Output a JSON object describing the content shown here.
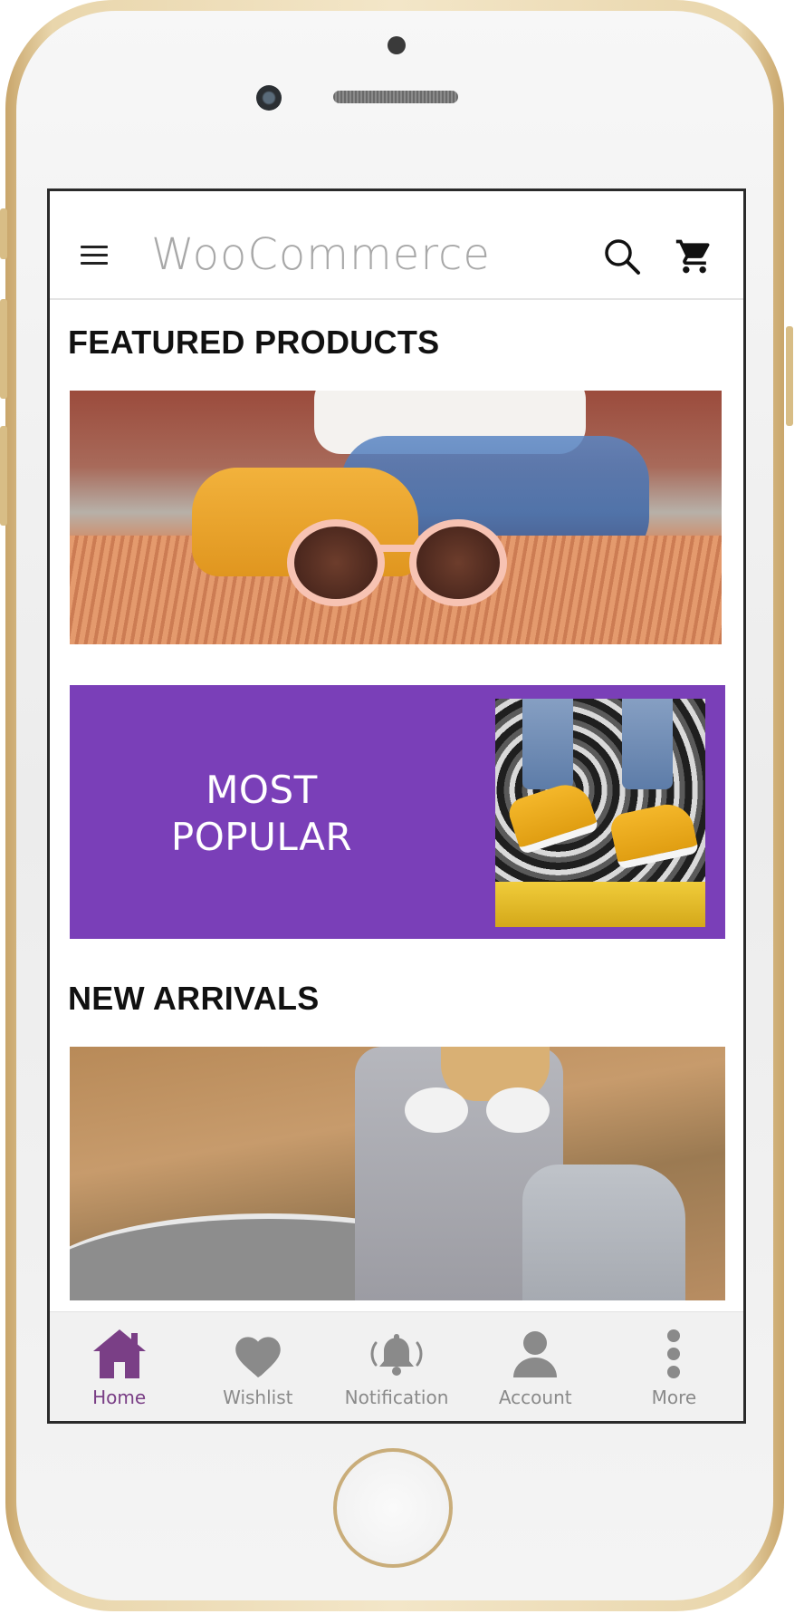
{
  "app_bar": {
    "title": "WooCommerce",
    "menu_icon": "hamburger-menu-icon",
    "search_icon": "search-icon",
    "cart_icon": "shopping-cart-icon"
  },
  "sections": {
    "featured": {
      "title": "FEATURED PRODUCTS"
    },
    "promo": {
      "line1": "MOST",
      "line2": "POPULAR"
    },
    "new_arrivals": {
      "title": "NEW ARRIVALS"
    }
  },
  "bottom_nav": {
    "items": [
      {
        "label": "Home",
        "icon": "home-icon",
        "active": true
      },
      {
        "label": "Wishlist",
        "icon": "heart-icon",
        "active": false
      },
      {
        "label": "Notification",
        "icon": "bell-icon",
        "active": false
      },
      {
        "label": "Account",
        "icon": "user-icon",
        "active": false
      },
      {
        "label": "More",
        "icon": "more-vertical-icon",
        "active": false
      }
    ]
  },
  "colors": {
    "accent": "#7a3fb8",
    "active_nav": "#7a3f86",
    "inactive_nav": "#8a8a8a",
    "title_gray": "#a8a8a8"
  }
}
